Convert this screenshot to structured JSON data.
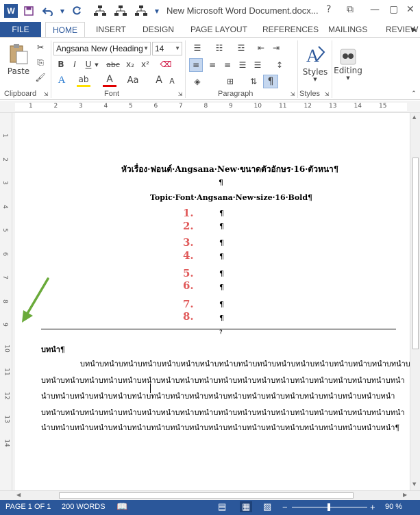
{
  "window": {
    "title": "New Microsoft Word Document.docx...",
    "help_glyph": "?",
    "ribbon_display_glyph": "⧉"
  },
  "quick_access": {
    "app_logo": "W"
  },
  "tabs": [
    "FILE",
    "HOME",
    "INSERT",
    "DESIGN",
    "PAGE LAYOUT",
    "REFERENCES",
    "MAILINGS",
    "REVIEW"
  ],
  "ribbon": {
    "clipboard": {
      "label": "Clipboard",
      "paste": "Paste"
    },
    "font": {
      "label": "Font",
      "font_name": "Angsana New (Heading",
      "font_size": "14",
      "bold": "B",
      "italic": "I",
      "underline": "U",
      "strike": "abc",
      "subscript": "x₂",
      "superscript": "x²",
      "change_case": "Aa",
      "grow": "A",
      "shrink": "A"
    },
    "paragraph": {
      "label": "Paragraph",
      "pilcrow": "¶"
    },
    "styles": {
      "label": "Styles",
      "button": "Styles"
    },
    "editing": {
      "button": "Editing"
    }
  },
  "ruler": {
    "h_numbers": [
      "1",
      "2",
      "3",
      "4",
      "5",
      "6",
      "7",
      "8",
      "9",
      "10",
      "11",
      "12",
      "13",
      "14",
      "15"
    ],
    "v_numbers": [
      "1",
      "2",
      "3",
      "4",
      "5",
      "6",
      "7",
      "8",
      "9",
      "10",
      "11",
      "12",
      "13",
      "14"
    ]
  },
  "document": {
    "heading_thai": "หัวเรื่อง·ฟอนต์·Angsana·New·ขนาดตัวอักษร·16·ตัวหนา¶",
    "empty_para": "¶",
    "heading_en": "Topic·Font·Angsana·New·size·16·Bold¶",
    "numbered_items": [
      "1.",
      "2.",
      "3.",
      "4.",
      "5.",
      "6.",
      "7.",
      "8."
    ],
    "section_break": "?",
    "section_title": "บทนำ¶",
    "body_lines": [
      "บทนำบทนำบทนำบทนำบทนำบทนำบทนำบทนำบทนำบทนำบทนำบทนำบทนำบทนำบทนำบทนำบทนำบทนำ",
      "บทนำบทนำบทนำบทนำบทนำบทนำบทนำบทนำบทนำบทนำบทนำบทนำบทนำบทนำบทนำบทนำบทนำบทนำบทนำ",
      "นำบทนำบทนำบทนำบทนำบทนำบทนำบทนำบทนำบทนำบทนำบทนำบทนำบทนำบทนำบทนำบทนำบทนำบทนำ",
      "บทนำบทนำบทนำบทนำบทนำบทนำบทนำบทนำบทนำบทนำบทนำบทนำบทนำบทนำบทนำบทนำบทนำบทนำบทนำ",
      "นำบทนำบทนำบทนำบทนำบทนำบทนำบทนำบทนำบทนำบทนำบทนำบทนำบทนำบทนำบทนำบทนำบทนำบทนำ¶"
    ]
  },
  "status": {
    "page": "PAGE 1 OF 1",
    "words": "200 WORDS",
    "zoom": "90 %",
    "zoom_out": "−",
    "zoom_in": "+"
  },
  "colors": {
    "accent": "#2b579a",
    "numbering": "#e05a5a",
    "arrow": "#6aaa3a"
  }
}
